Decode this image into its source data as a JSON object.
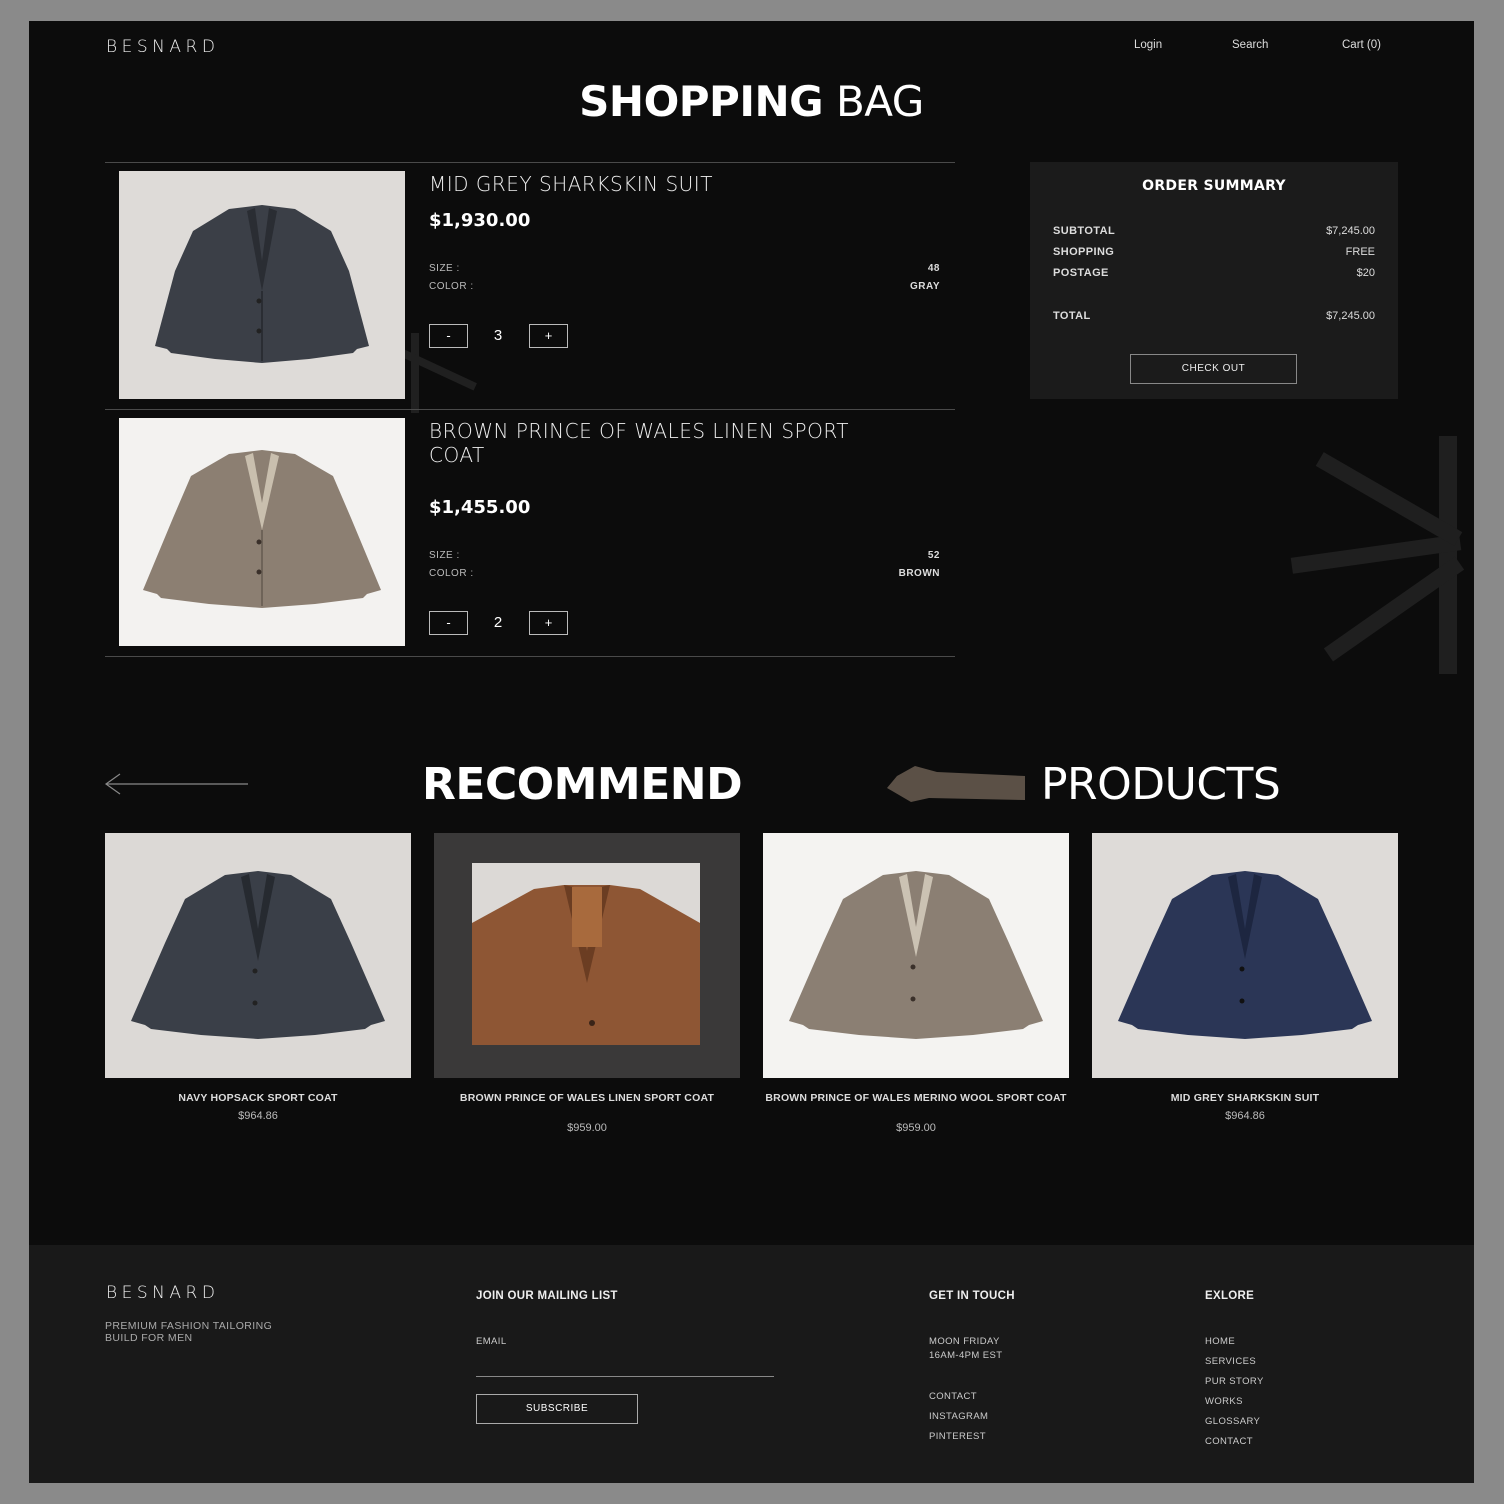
{
  "header": {
    "brand": "BESNARD",
    "nav": {
      "login": "Login",
      "search": "Search",
      "cart": "Cart (0)"
    }
  },
  "page_title": {
    "bold": "SHOPPING",
    "light": "BAG"
  },
  "cart_items": [
    {
      "name": "MID GREY SHARKSKIN SUIT",
      "price": "$1,930.00",
      "size_label": "SIZE :",
      "size_value": "48",
      "color_label": "COLOR :",
      "color_value": "GRAY",
      "quantity": "3",
      "minus": "-",
      "plus": "+"
    },
    {
      "name": "BROWN PRINCE OF WALES LINEN SPORT COAT",
      "price": "$1,455.00",
      "size_label": "SIZE :",
      "size_value": "52",
      "color_label": "COLOR :",
      "color_value": "BROWN",
      "quantity": "2",
      "minus": "-",
      "plus": "+"
    }
  ],
  "order_summary": {
    "title": "ORDER SUMMARY",
    "rows": [
      {
        "label": "SUBTOTAL",
        "value": "$7,245.00"
      },
      {
        "label": "SHOPPING",
        "value": "FREE"
      },
      {
        "label": "POSTAGE",
        "value": "$20"
      },
      {
        "label": "TOTAL",
        "value": "$7,245.00"
      }
    ],
    "checkout_label": "CHECK OUT"
  },
  "recommend": {
    "title_bold": "RECOMMEND",
    "title_light": "PRODUCTS",
    "products": [
      {
        "name": "NAVY HOPSACK SPORT COAT",
        "price": "$964.86"
      },
      {
        "name": "BROWN PRINCE OF WALES LINEN SPORT COAT",
        "price": "$959.00"
      },
      {
        "name": "BROWN PRINCE OF WALES MERINO WOOL SPORT COAT",
        "price": "$959.00"
      },
      {
        "name": "MID GREY SHARKSKIN SUIT",
        "price": "$964.86"
      }
    ]
  },
  "footer": {
    "brand": "BESNARD",
    "tagline_1": "PREMIUM FASHION TAILORING",
    "tagline_2": "BUILD FOR MEN",
    "mailing_title": "JOIN OUR MAILING LIST",
    "email_label": "EMAIL",
    "subscribe_label": "SUBSCRIBE",
    "contact_title": "GET IN TOUCH",
    "hours_1": "MOON FRIDAY",
    "hours_2": "16AM-4PM EST",
    "contact_links": [
      "CONTACT",
      "INSTAGRAM",
      "PINTEREST"
    ],
    "explore_title": "EXLORE",
    "explore_links": [
      "HOME",
      "SERVICES",
      "PUR STORY",
      "WORKS",
      "GLOSSARY",
      "CONTACT"
    ]
  },
  "colors": {
    "background": "#0c0c0c",
    "footer": "#191919",
    "summary_panel": "#1b1b1b",
    "outer_frame": "#8a8a8a"
  }
}
